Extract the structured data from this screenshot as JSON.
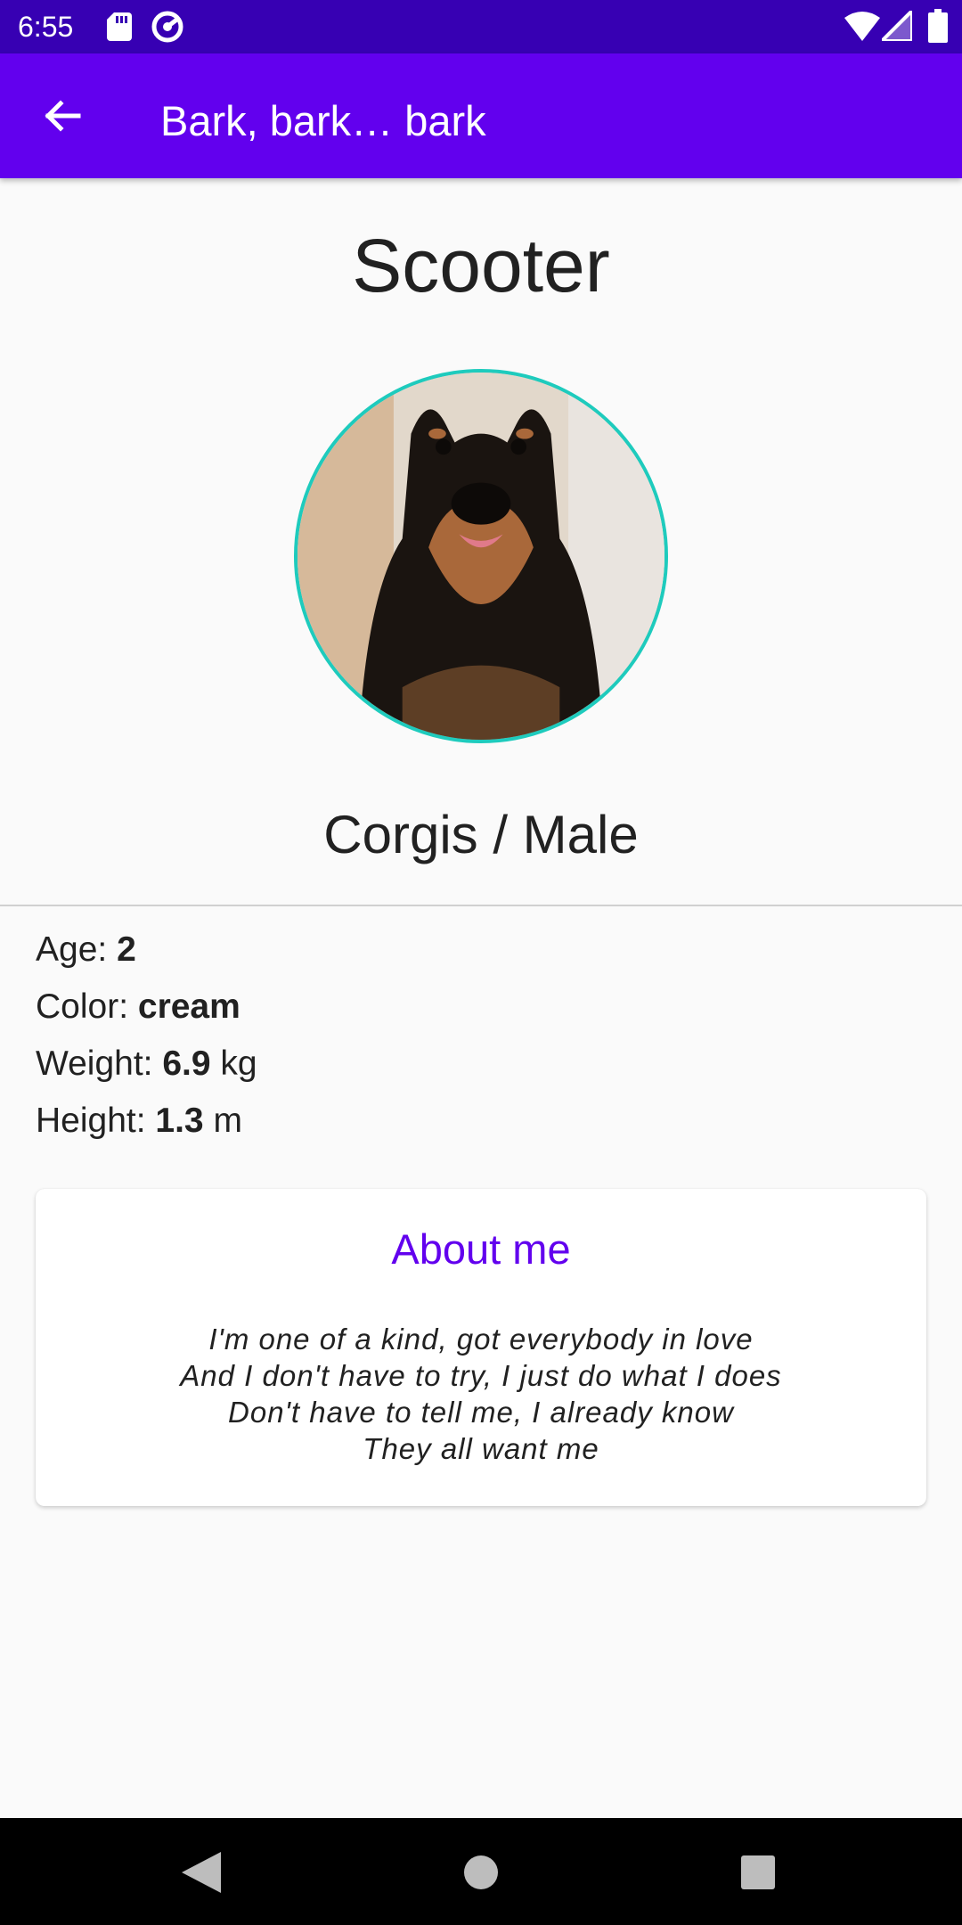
{
  "status_bar": {
    "time": "6:55",
    "icons": [
      "sd-card-icon",
      "sync-icon",
      "wifi-icon",
      "signal-icon",
      "battery-icon"
    ]
  },
  "app_bar": {
    "back_icon": "arrow-left-icon",
    "title": "Bark, bark… bark",
    "background_color": "#6200ee"
  },
  "dog": {
    "name": "Scooter",
    "photo": "dog-photo",
    "breed_sex": "Corgis / Male",
    "age_label": "Age: ",
    "age_value": "2",
    "color_label": "Color: ",
    "color_value": "cream",
    "weight_label": "Weight: ",
    "weight_value": "6.9",
    "weight_unit": " kg",
    "height_label": "Height: ",
    "height_value": "1.3",
    "height_unit": " m"
  },
  "about": {
    "title": "About me",
    "lines": [
      "I'm one of a kind, got everybody in love",
      "And I don't have to try, I just do what I does",
      "Don't have to tell me, I already know",
      "They all want me"
    ],
    "title_color": "#6200ee"
  },
  "colors": {
    "status_bar": "#3700b3",
    "photo_border": "#1ecbbd"
  },
  "nav_bar": {
    "icons": [
      "nav-back-icon",
      "nav-home-icon",
      "nav-recents-icon"
    ]
  }
}
